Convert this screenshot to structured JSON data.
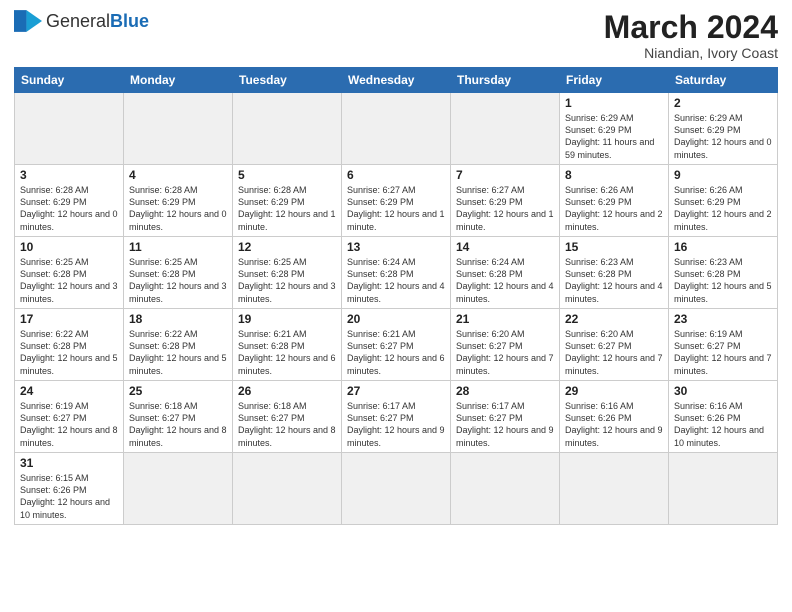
{
  "header": {
    "logo_general": "General",
    "logo_blue": "Blue",
    "title": "March 2024",
    "subtitle": "Niandian, Ivory Coast"
  },
  "weekdays": [
    "Sunday",
    "Monday",
    "Tuesday",
    "Wednesday",
    "Thursday",
    "Friday",
    "Saturday"
  ],
  "weeks": [
    [
      {
        "day": "",
        "info": ""
      },
      {
        "day": "",
        "info": ""
      },
      {
        "day": "",
        "info": ""
      },
      {
        "day": "",
        "info": ""
      },
      {
        "day": "",
        "info": ""
      },
      {
        "day": "1",
        "info": "Sunrise: 6:29 AM\nSunset: 6:29 PM\nDaylight: 11 hours and 59 minutes."
      },
      {
        "day": "2",
        "info": "Sunrise: 6:29 AM\nSunset: 6:29 PM\nDaylight: 12 hours and 0 minutes."
      }
    ],
    [
      {
        "day": "3",
        "info": "Sunrise: 6:28 AM\nSunset: 6:29 PM\nDaylight: 12 hours and 0 minutes."
      },
      {
        "day": "4",
        "info": "Sunrise: 6:28 AM\nSunset: 6:29 PM\nDaylight: 12 hours and 0 minutes."
      },
      {
        "day": "5",
        "info": "Sunrise: 6:28 AM\nSunset: 6:29 PM\nDaylight: 12 hours and 1 minute."
      },
      {
        "day": "6",
        "info": "Sunrise: 6:27 AM\nSunset: 6:29 PM\nDaylight: 12 hours and 1 minute."
      },
      {
        "day": "7",
        "info": "Sunrise: 6:27 AM\nSunset: 6:29 PM\nDaylight: 12 hours and 1 minute."
      },
      {
        "day": "8",
        "info": "Sunrise: 6:26 AM\nSunset: 6:29 PM\nDaylight: 12 hours and 2 minutes."
      },
      {
        "day": "9",
        "info": "Sunrise: 6:26 AM\nSunset: 6:29 PM\nDaylight: 12 hours and 2 minutes."
      }
    ],
    [
      {
        "day": "10",
        "info": "Sunrise: 6:25 AM\nSunset: 6:28 PM\nDaylight: 12 hours and 3 minutes."
      },
      {
        "day": "11",
        "info": "Sunrise: 6:25 AM\nSunset: 6:28 PM\nDaylight: 12 hours and 3 minutes."
      },
      {
        "day": "12",
        "info": "Sunrise: 6:25 AM\nSunset: 6:28 PM\nDaylight: 12 hours and 3 minutes."
      },
      {
        "day": "13",
        "info": "Sunrise: 6:24 AM\nSunset: 6:28 PM\nDaylight: 12 hours and 4 minutes."
      },
      {
        "day": "14",
        "info": "Sunrise: 6:24 AM\nSunset: 6:28 PM\nDaylight: 12 hours and 4 minutes."
      },
      {
        "day": "15",
        "info": "Sunrise: 6:23 AM\nSunset: 6:28 PM\nDaylight: 12 hours and 4 minutes."
      },
      {
        "day": "16",
        "info": "Sunrise: 6:23 AM\nSunset: 6:28 PM\nDaylight: 12 hours and 5 minutes."
      }
    ],
    [
      {
        "day": "17",
        "info": "Sunrise: 6:22 AM\nSunset: 6:28 PM\nDaylight: 12 hours and 5 minutes."
      },
      {
        "day": "18",
        "info": "Sunrise: 6:22 AM\nSunset: 6:28 PM\nDaylight: 12 hours and 5 minutes."
      },
      {
        "day": "19",
        "info": "Sunrise: 6:21 AM\nSunset: 6:28 PM\nDaylight: 12 hours and 6 minutes."
      },
      {
        "day": "20",
        "info": "Sunrise: 6:21 AM\nSunset: 6:27 PM\nDaylight: 12 hours and 6 minutes."
      },
      {
        "day": "21",
        "info": "Sunrise: 6:20 AM\nSunset: 6:27 PM\nDaylight: 12 hours and 7 minutes."
      },
      {
        "day": "22",
        "info": "Sunrise: 6:20 AM\nSunset: 6:27 PM\nDaylight: 12 hours and 7 minutes."
      },
      {
        "day": "23",
        "info": "Sunrise: 6:19 AM\nSunset: 6:27 PM\nDaylight: 12 hours and 7 minutes."
      }
    ],
    [
      {
        "day": "24",
        "info": "Sunrise: 6:19 AM\nSunset: 6:27 PM\nDaylight: 12 hours and 8 minutes."
      },
      {
        "day": "25",
        "info": "Sunrise: 6:18 AM\nSunset: 6:27 PM\nDaylight: 12 hours and 8 minutes."
      },
      {
        "day": "26",
        "info": "Sunrise: 6:18 AM\nSunset: 6:27 PM\nDaylight: 12 hours and 8 minutes."
      },
      {
        "day": "27",
        "info": "Sunrise: 6:17 AM\nSunset: 6:27 PM\nDaylight: 12 hours and 9 minutes."
      },
      {
        "day": "28",
        "info": "Sunrise: 6:17 AM\nSunset: 6:27 PM\nDaylight: 12 hours and 9 minutes."
      },
      {
        "day": "29",
        "info": "Sunrise: 6:16 AM\nSunset: 6:26 PM\nDaylight: 12 hours and 9 minutes."
      },
      {
        "day": "30",
        "info": "Sunrise: 6:16 AM\nSunset: 6:26 PM\nDaylight: 12 hours and 10 minutes."
      }
    ],
    [
      {
        "day": "31",
        "info": "Sunrise: 6:15 AM\nSunset: 6:26 PM\nDaylight: 12 hours and 10 minutes."
      },
      {
        "day": "",
        "info": ""
      },
      {
        "day": "",
        "info": ""
      },
      {
        "day": "",
        "info": ""
      },
      {
        "day": "",
        "info": ""
      },
      {
        "day": "",
        "info": ""
      },
      {
        "day": "",
        "info": ""
      }
    ]
  ]
}
